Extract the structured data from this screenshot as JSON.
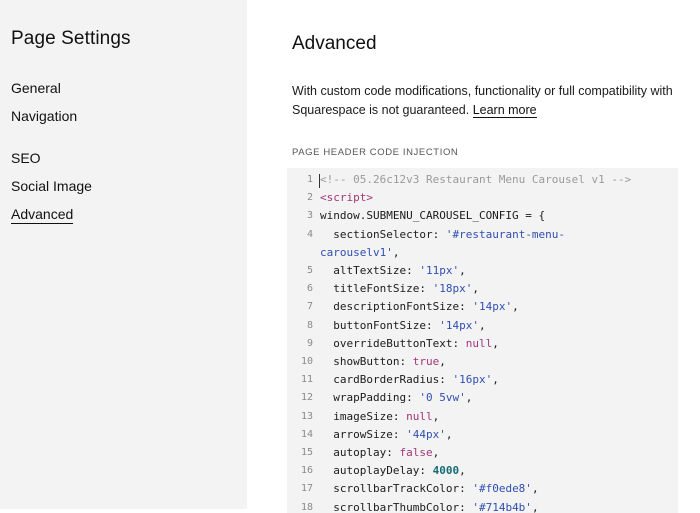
{
  "sidebar": {
    "title": "Page Settings",
    "items": [
      {
        "label": "General",
        "active": false
      },
      {
        "label": "Navigation",
        "active": false
      },
      {
        "label": "SEO",
        "active": false
      },
      {
        "label": "Social Image",
        "active": false
      },
      {
        "label": "Advanced",
        "active": true
      }
    ]
  },
  "main": {
    "title": "Advanced",
    "description": "With custom code modifications, functionality or full compatibility with Squarespace is not guaranteed.",
    "learn_more": "Learn more",
    "section_label": "PAGE HEADER CODE INJECTION"
  },
  "editor": {
    "lines": [
      {
        "num": "1",
        "segs": [
          {
            "t": "<!-- 05.26c12v3 Restaurant Menu Carousel v1 -->",
            "c": "comment"
          }
        ]
      },
      {
        "num": "2",
        "segs": [
          {
            "t": "<script>",
            "c": "tag"
          }
        ]
      },
      {
        "num": "3",
        "segs": [
          {
            "t": "window.SUBMENU_CAROUSEL_CONFIG = {",
            "c": ""
          }
        ]
      },
      {
        "num": "4",
        "segs": [
          {
            "t": "  sectionSelector: ",
            "c": ""
          },
          {
            "t": "'#restaurant-menu-",
            "c": "str"
          }
        ]
      },
      {
        "num": "",
        "segs": [
          {
            "t": "carouselv1'",
            "c": "str"
          },
          {
            "t": ",",
            "c": ""
          }
        ]
      },
      {
        "num": "5",
        "segs": [
          {
            "t": "  altTextSize: ",
            "c": ""
          },
          {
            "t": "'11px'",
            "c": "str"
          },
          {
            "t": ",",
            "c": ""
          }
        ]
      },
      {
        "num": "6",
        "segs": [
          {
            "t": "  titleFontSize: ",
            "c": ""
          },
          {
            "t": "'18px'",
            "c": "str"
          },
          {
            "t": ",",
            "c": ""
          }
        ]
      },
      {
        "num": "7",
        "segs": [
          {
            "t": "  descriptionFontSize: ",
            "c": ""
          },
          {
            "t": "'14px'",
            "c": "str"
          },
          {
            "t": ",",
            "c": ""
          }
        ]
      },
      {
        "num": "8",
        "segs": [
          {
            "t": "  buttonFontSize: ",
            "c": ""
          },
          {
            "t": "'14px'",
            "c": "str"
          },
          {
            "t": ",",
            "c": ""
          }
        ]
      },
      {
        "num": "9",
        "segs": [
          {
            "t": "  overrideButtonText: ",
            "c": ""
          },
          {
            "t": "null",
            "c": "kw"
          },
          {
            "t": ",",
            "c": ""
          }
        ]
      },
      {
        "num": "10",
        "segs": [
          {
            "t": "  showButton: ",
            "c": ""
          },
          {
            "t": "true",
            "c": "kw"
          },
          {
            "t": ",",
            "c": ""
          }
        ]
      },
      {
        "num": "11",
        "segs": [
          {
            "t": "  cardBorderRadius: ",
            "c": ""
          },
          {
            "t": "'16px'",
            "c": "str"
          },
          {
            "t": ",",
            "c": ""
          }
        ]
      },
      {
        "num": "12",
        "segs": [
          {
            "t": "  wrapPadding: ",
            "c": ""
          },
          {
            "t": "'0 5vw'",
            "c": "str"
          },
          {
            "t": ",",
            "c": ""
          }
        ]
      },
      {
        "num": "13",
        "segs": [
          {
            "t": "  imageSize: ",
            "c": ""
          },
          {
            "t": "null",
            "c": "kw"
          },
          {
            "t": ",",
            "c": ""
          }
        ]
      },
      {
        "num": "14",
        "segs": [
          {
            "t": "  arrowSize: ",
            "c": ""
          },
          {
            "t": "'44px'",
            "c": "str"
          },
          {
            "t": ",",
            "c": ""
          }
        ]
      },
      {
        "num": "15",
        "segs": [
          {
            "t": "  autoplay: ",
            "c": ""
          },
          {
            "t": "false",
            "c": "kw"
          },
          {
            "t": ",",
            "c": ""
          }
        ]
      },
      {
        "num": "16",
        "segs": [
          {
            "t": "  autoplayDelay: ",
            "c": ""
          },
          {
            "t": "4000",
            "c": "num"
          },
          {
            "t": ",",
            "c": ""
          }
        ]
      },
      {
        "num": "17",
        "segs": [
          {
            "t": "  scrollbarTrackColor: ",
            "c": ""
          },
          {
            "t": "'#f0ede8'",
            "c": "str"
          },
          {
            "t": ",",
            "c": ""
          }
        ]
      },
      {
        "num": "18",
        "segs": [
          {
            "t": "  scrollbarThumbColor: ",
            "c": ""
          },
          {
            "t": "'#714b4b'",
            "c": "str"
          },
          {
            "t": ",",
            "c": ""
          }
        ]
      }
    ]
  }
}
